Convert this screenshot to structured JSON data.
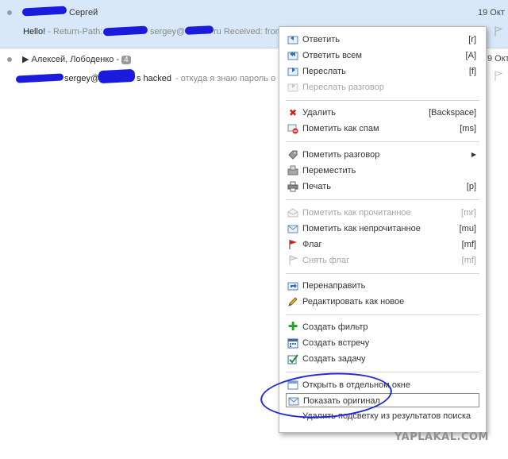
{
  "messages": [
    {
      "sender": "Сергей",
      "date": "19 Окт",
      "subject": "Hello!",
      "snippet_a": " - Return-Path:",
      "snippet_b": "sergey@",
      "snippet_c": "ru Received: from"
    },
    {
      "sender": "Алексей, Лободенко -",
      "count": "4",
      "date": "9 Окт",
      "subject_a": "sergey@",
      "subject_b": "s hacked",
      "snippet": " - откуда я знаю пароль о"
    }
  ],
  "context_menu": {
    "reply": {
      "label": "Ответить",
      "shortcut": "[r]"
    },
    "reply_all": {
      "label": "Ответить всем",
      "shortcut": "[A]"
    },
    "forward": {
      "label": "Переслать",
      "shortcut": "[f]"
    },
    "forward_conversation": {
      "label": "Переслать разговор"
    },
    "delete": {
      "label": "Удалить",
      "shortcut": "[Backspace]"
    },
    "mark_spam": {
      "label": "Пометить как спам",
      "shortcut": "[ms]"
    },
    "tag_conversation": {
      "label": "Пометить разговор"
    },
    "move": {
      "label": "Переместить"
    },
    "print": {
      "label": "Печать",
      "shortcut": "[p]"
    },
    "mark_read": {
      "label": "Пометить как прочитанное",
      "shortcut": "[mr]"
    },
    "mark_unread": {
      "label": "Пометить как непрочитанное",
      "shortcut": "[mu]"
    },
    "flag": {
      "label": "Флаг",
      "shortcut": "[mf]"
    },
    "unflag": {
      "label": "Снять флаг",
      "shortcut": "[mf]"
    },
    "redirect": {
      "label": "Перенаправить"
    },
    "edit_as_new": {
      "label": "Редактировать как новое"
    },
    "create_filter": {
      "label": "Создать фильтр"
    },
    "create_appointment": {
      "label": "Создать встречу"
    },
    "create_task": {
      "label": "Создать задачу"
    },
    "open_new_window": {
      "label": "Открыть в отдельном окне"
    },
    "show_original": {
      "label": "Показать оригинал"
    },
    "remove_highlight": {
      "label": "Удалить подсветку из результатов поиска"
    }
  },
  "watermark": "YAPLAKAL.COM",
  "colors": {
    "selected_row": "#d8e8f8",
    "scribble": "#1b1bdd",
    "annotation_circle": "#1e2bd6"
  }
}
